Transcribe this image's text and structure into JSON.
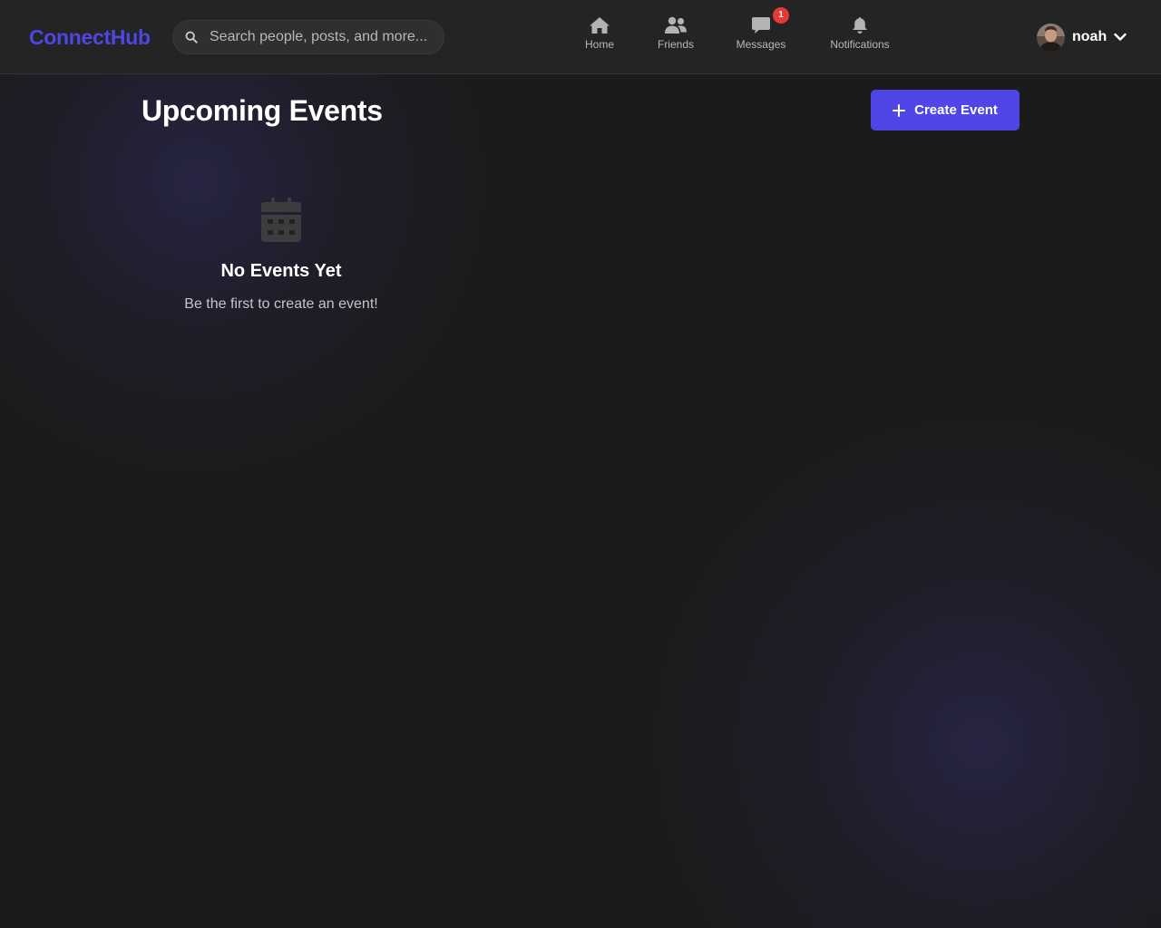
{
  "header": {
    "logo": "ConnectHub",
    "search": {
      "placeholder": "Search people, posts, and more..."
    },
    "nav": [
      {
        "label": "Home",
        "icon": "home-icon"
      },
      {
        "label": "Friends",
        "icon": "friends-icon"
      },
      {
        "label": "Messages",
        "icon": "message-icon",
        "badge": "1"
      },
      {
        "label": "Notifications",
        "icon": "bell-icon"
      }
    ],
    "user": {
      "name": "noah",
      "icon": "chevron-down-icon"
    }
  },
  "main": {
    "title": "Upcoming Events",
    "create_button": "Create Event",
    "empty": {
      "icon": "calendar-icon",
      "title": "No Events Yet",
      "subtitle": "Be the first to create an event!"
    }
  },
  "colors": {
    "accent": "#4f46e5",
    "background": "#1b1b1c",
    "header": "#242425",
    "badge": "#e53935"
  }
}
